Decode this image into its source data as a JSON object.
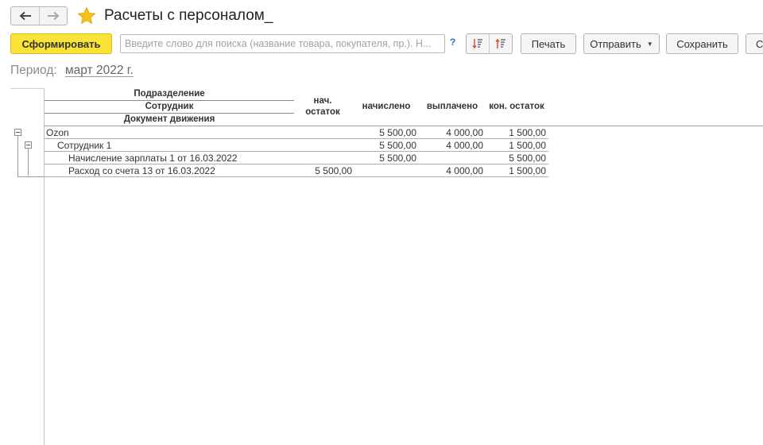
{
  "window": {
    "title": "Расчеты с персоналом_"
  },
  "toolbar": {
    "generate_label": "Сформировать",
    "search_placeholder": "Введите слово для поиска (название товара, покупателя, пр.). Н...",
    "search_value": "",
    "help_label": "?",
    "print_label": "Печать",
    "send_label": "Отправить",
    "save_label": "Сохранить",
    "clipped_button_label": "С"
  },
  "period": {
    "label": "Период:",
    "value": "март 2022 г."
  },
  "report": {
    "header": {
      "group1": "Подразделение",
      "group2": "Сотрудник",
      "group3": "Документ движения",
      "col_start_line1": "нач.",
      "col_start_line2": "остаток",
      "col_accrued": "начислено",
      "col_paid": "выплачено",
      "col_end": "кон. остаток"
    },
    "rows": [
      {
        "name": "Ozon",
        "start": "",
        "accrued": "5 500,00",
        "paid": "4 000,00",
        "end": "1 500,00"
      },
      {
        "name": "Сотрудник 1",
        "start": "",
        "accrued": "5 500,00",
        "paid": "4 000,00",
        "end": "1 500,00"
      },
      {
        "name": "Начисление зарплаты 1 от 16.03.2022",
        "start": "",
        "accrued": "5 500,00",
        "paid": "",
        "end": "5 500,00"
      },
      {
        "name": "Расход со счета 13  от 16.03.2022",
        "start": "5 500,00",
        "accrued": "",
        "paid": "4 000,00",
        "end": "1 500,00"
      }
    ]
  },
  "icons": {
    "back": "arrow-left-icon",
    "forward": "arrow-right-icon",
    "favorite": "star-icon",
    "sort_asc": "sort-ascending-icon",
    "sort_desc": "sort-descending-icon",
    "dropdown": "chevron-down-icon"
  },
  "colors": {
    "primary_button": "#fbe236",
    "favorite_star": "#f3c21b",
    "help": "#2a6fb0",
    "sort_icon_accent": "#d9442b"
  }
}
